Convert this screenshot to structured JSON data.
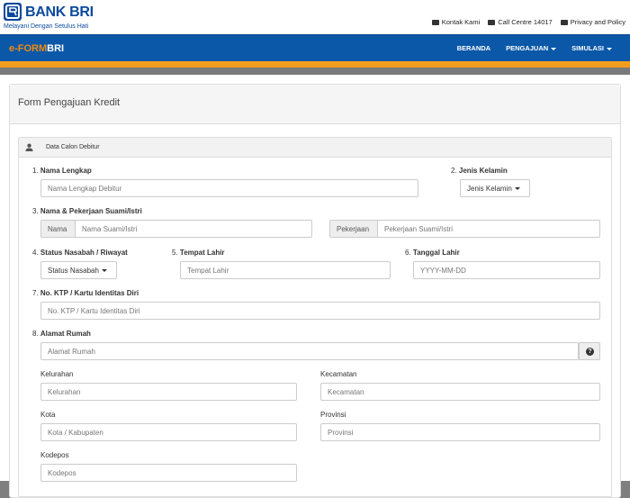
{
  "header": {
    "logo_text": "BANK BRI",
    "tagline": "Melayani Dengan Setulus Hati",
    "links": [
      {
        "label": "Kontak Kami",
        "icon": "envelope-icon"
      },
      {
        "label": "Call Centre 14017",
        "icon": "phone-icon"
      },
      {
        "label": "Privacy and Policy",
        "icon": "briefcase-icon"
      }
    ]
  },
  "navbar": {
    "brand_prefix": "e-FORM",
    "brand_suffix": "BRI",
    "items": [
      "BERANDA",
      "PENGAJUAN",
      "SIMULASI"
    ]
  },
  "panel": {
    "title": "Form Pengajuan Kredit",
    "section_title": "Data Calon Debitur"
  },
  "form": {
    "nama_label_num": "1.",
    "nama_label": "Nama Lengkap",
    "nama_placeholder": "Nama Lengkap Debitur",
    "jk_label_num": "2.",
    "jk_label": "Jenis Kelamin",
    "jk_value": "Jenis Kelamin",
    "suami_label_num": "3.",
    "suami_label": "Nama & Pekerjaan Suami/Istri",
    "suami_nama_addon": "Nama",
    "suami_nama_placeholder": "Nama Suami/Istri",
    "suami_kerja_addon": "Pekerjaan",
    "suami_kerja_placeholder": "Pekerjaan Suami/Istri",
    "status_label_num": "4.",
    "status_label": "Status Nasabah / Riwayat",
    "status_value": "Status Nasabah",
    "tempat_label_num": "5.",
    "tempat_label": "Tempat Lahir",
    "tempat_placeholder": "Tempat Lahir",
    "tgl_label_num": "6.",
    "tgl_label": "Tanggal Lahir",
    "tgl_placeholder": "YYYY-MM-DD",
    "ktp_label_num": "7.",
    "ktp_label": "No. KTP / Kartu Identitas Diri",
    "ktp_placeholder": "No. KTP / Kartu Identitas Diri",
    "alamat_label_num": "8.",
    "alamat_label": "Alamat Rumah",
    "alamat_placeholder": "Alamat Rumah",
    "kelurahan_label": "Kelurahan",
    "kelurahan_placeholder": "Kelurahan",
    "kecamatan_label": "Kecamatan",
    "kecamatan_placeholder": "Kecamatan",
    "kota_label": "Kota",
    "kota_placeholder": "Kota / Kabupaten",
    "provinsi_label": "Provinsi",
    "provinsi_placeholder": "Provinsi",
    "kodepos_label": "Kodepos",
    "kodepos_placeholder": "Kodepos"
  },
  "colors": {
    "navbar": "#0b58a8",
    "accent_orange": "#f29d1f",
    "brand_blue": "#0a4a9c"
  }
}
